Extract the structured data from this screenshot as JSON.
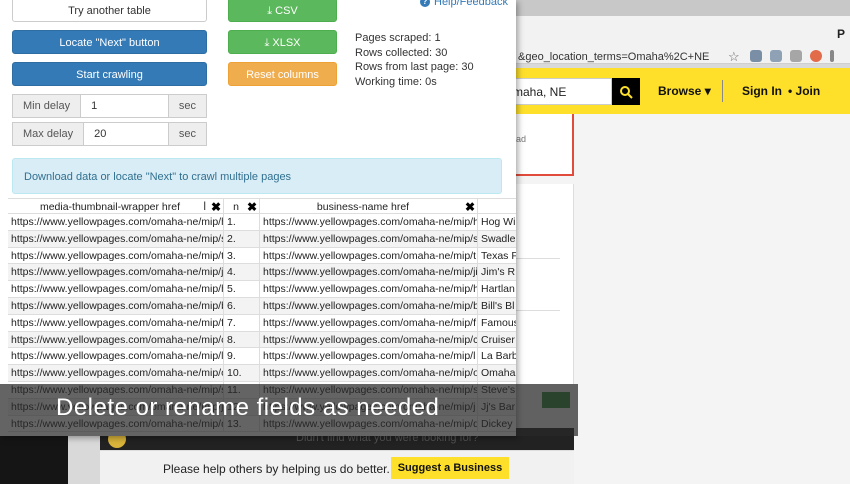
{
  "browser": {
    "url_fragment": "&geo_location_terms=Omaha%2C+NE",
    "profile_letter": "P"
  },
  "site": {
    "search_value": "maha, NE",
    "nav_browse": "Browse",
    "nav_signin": "Sign In",
    "nav_join": "Join",
    "partial_text": "ad",
    "dark_bar_text": "Didn't find what you were looking for?",
    "help_text": "Please help others by helping us do better.",
    "suggest_label": "Suggest a Business"
  },
  "scraper": {
    "buttons": {
      "try_another": "Try another table",
      "csv": "CSV",
      "xlsx": "XLSX",
      "locate_next": "Locate \"Next\" button",
      "reset_columns": "Reset columns",
      "start_crawling": "Start crawling"
    },
    "help_label": "Help/Feedback",
    "min_delay": {
      "label": "Min delay",
      "value": "1",
      "unit": "sec"
    },
    "max_delay": {
      "label": "Max delay",
      "value": "20",
      "unit": "sec"
    },
    "stats": {
      "pages_scraped": "Pages scraped: 1",
      "rows_collected": "Rows collected: 30",
      "rows_last_page": "Rows from last page: 30",
      "working_time": "Working time: 0s"
    },
    "info_text": "Download data or locate \"Next\" to crawl multiple pages",
    "table": {
      "headers": [
        "media-thumbnail-wrapper href",
        "n",
        "business-name href",
        ""
      ],
      "rows": [
        [
          "https://www.yellowpages.com/omaha-ne/mip/h",
          "1.",
          "https://www.yellowpages.com/omaha-ne/mip/h",
          "Hog Wi"
        ],
        [
          "https://www.yellowpages.com/omaha-ne/mip/s",
          "2.",
          "https://www.yellowpages.com/omaha-ne/mip/s",
          "Swadle"
        ],
        [
          "https://www.yellowpages.com/omaha-ne/mip/t",
          "3.",
          "https://www.yellowpages.com/omaha-ne/mip/t",
          "Texas F"
        ],
        [
          "https://www.yellowpages.com/omaha-ne/mip/ji",
          "4.",
          "https://www.yellowpages.com/omaha-ne/mip/ji",
          "Jim's R"
        ],
        [
          "https://www.yellowpages.com/omaha-ne/mip/h",
          "5.",
          "https://www.yellowpages.com/omaha-ne/mip/h",
          "Hartlan"
        ],
        [
          "https://www.yellowpages.com/omaha-ne/mip/b",
          "6.",
          "https://www.yellowpages.com/omaha-ne/mip/b",
          "Bill's Bl"
        ],
        [
          "https://www.yellowpages.com/omaha-ne/mip/f",
          "7.",
          "https://www.yellowpages.com/omaha-ne/mip/f",
          "Famous"
        ],
        [
          "https://www.yellowpages.com/omaha-ne/mip/c",
          "8.",
          "https://www.yellowpages.com/omaha-ne/mip/c",
          "Cruiser"
        ],
        [
          "https://www.yellowpages.com/omaha-ne/mip/l",
          "9.",
          "https://www.yellowpages.com/omaha-ne/mip/l",
          "La Barb"
        ],
        [
          "https://www.yellowpages.com/omaha-ne/mip/o",
          "10.",
          "https://www.yellowpages.com/omaha-ne/mip/o",
          "Omaha"
        ],
        [
          "https://www.yellowpages.com/omaha-ne/mip/s",
          "11.",
          "https://www.yellowpages.com/omaha-ne/mip/s",
          "Steve's"
        ],
        [
          "https://www.yellowpages.com/omaha-ne/mip/j",
          "12.",
          "https://www.yellowpages.com/omaha-ne/mip/j",
          "Jj's Bar"
        ],
        [
          "https://www.yellowpages.com/omaha-ne/mip/d",
          "13.",
          "https://www.yellowpages.com/omaha-ne/mip/d",
          "Dickey"
        ]
      ]
    }
  },
  "caption": "Delete or rename fields as needed"
}
